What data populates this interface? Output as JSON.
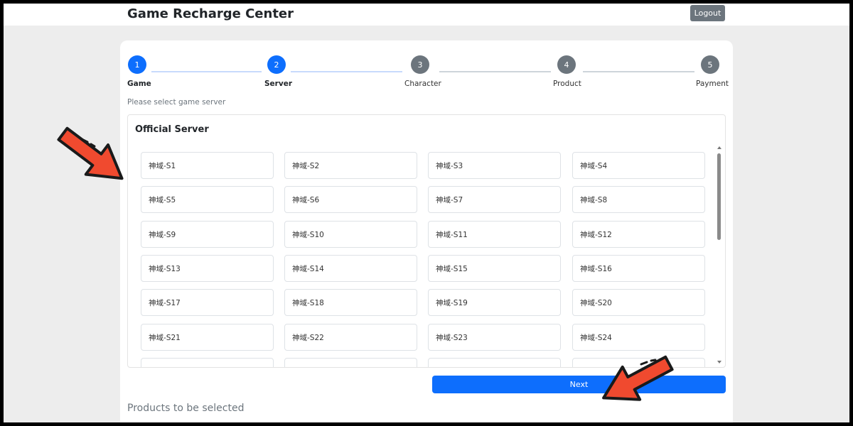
{
  "header": {
    "title": "Game Recharge Center",
    "logout_label": "Logout"
  },
  "steps": [
    {
      "number": "1",
      "label": "Game",
      "state": "active"
    },
    {
      "number": "2",
      "label": "Server",
      "state": "active"
    },
    {
      "number": "3",
      "label": "Character",
      "state": "inactive"
    },
    {
      "number": "4",
      "label": "Product",
      "state": "inactive"
    },
    {
      "number": "5",
      "label": "Payment",
      "state": "inactive"
    }
  ],
  "hint": "Please select game server",
  "server_panel": {
    "title": "Official Server",
    "servers": [
      "神域-S1",
      "神域-S2",
      "神域-S3",
      "神域-S4",
      "神域-S5",
      "神域-S6",
      "神域-S7",
      "神域-S8",
      "神域-S9",
      "神域-S10",
      "神域-S11",
      "神域-S12",
      "神域-S13",
      "神域-S14",
      "神域-S15",
      "神域-S16",
      "神域-S17",
      "神域-S18",
      "神域-S19",
      "神域-S20",
      "神域-S21",
      "神域-S22",
      "神域-S23",
      "神域-S24",
      "",
      "",
      "",
      ""
    ]
  },
  "next_label": "Next",
  "products_title": "Products to be selected",
  "colors": {
    "primary": "#0d6efd",
    "secondary": "#6c757d",
    "annotation_arrow": "#f04a2f"
  }
}
